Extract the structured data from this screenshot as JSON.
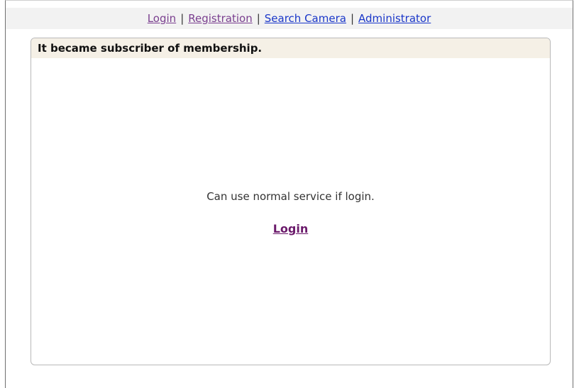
{
  "nav": {
    "login": "Login",
    "registration": "Registration",
    "search_camera": "Search Camera",
    "administrator": "Administrator",
    "separator": "|"
  },
  "panel": {
    "header": "It became subscriber of membership.",
    "message": "Can use normal service if login.",
    "login_link": "Login"
  },
  "colors": {
    "visited_link": "#7a3f8f",
    "unvisited_link": "#1a37c9",
    "panel_header_bg": "#f5f0e6",
    "nav_bar_bg": "#f2f2f2"
  }
}
